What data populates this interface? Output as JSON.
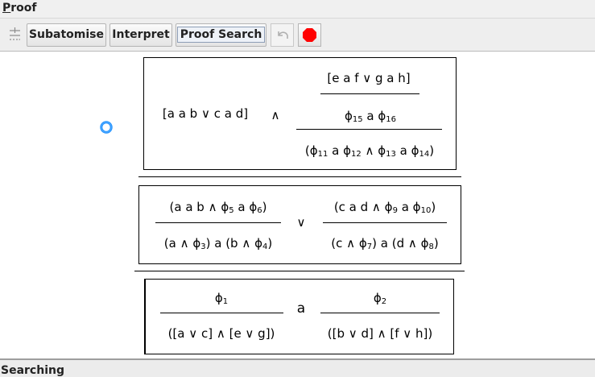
{
  "window": {
    "title_first": "P",
    "title_rest": "roof"
  },
  "toolbar": {
    "subatomise_label": "Subatomise",
    "interpret_label": "Interpret",
    "proof_search_label": "Proof Search"
  },
  "status": {
    "text": "Searching"
  },
  "proof": {
    "box1": {
      "left": "[a a b ∨ c a d]",
      "op": "∧",
      "top": "[e a f ∨ g a h]",
      "middle": [
        "ϕ",
        "15",
        " a ϕ",
        "16"
      ],
      "bottom": [
        "(ϕ",
        "11",
        " a ϕ",
        "12",
        " ∧ ϕ",
        "13",
        " a ϕ",
        "14",
        ")"
      ]
    },
    "box2": {
      "left_num": [
        "(a a b ∧ ϕ",
        "5",
        " a ϕ",
        "6",
        ")"
      ],
      "left_den": [
        "(a ∧ ϕ",
        "3",
        ") a (b ∧ ϕ",
        "4",
        ")"
      ],
      "op": "∨",
      "right_num": [
        "(c a d ∧ ϕ",
        "9",
        " a ϕ",
        "10",
        ")"
      ],
      "right_den": [
        "(c ∧ ϕ",
        "7",
        ") a (d ∧ ϕ",
        "8",
        ")"
      ]
    },
    "box3": {
      "left_num": [
        "ϕ",
        "1"
      ],
      "left_den": "([a ∨ c] ∧ [e ∨ g])",
      "op": "a",
      "right_num": [
        "ϕ",
        "2"
      ],
      "right_den": "([b ∨ d] ∧ [f ∨ h])"
    }
  }
}
